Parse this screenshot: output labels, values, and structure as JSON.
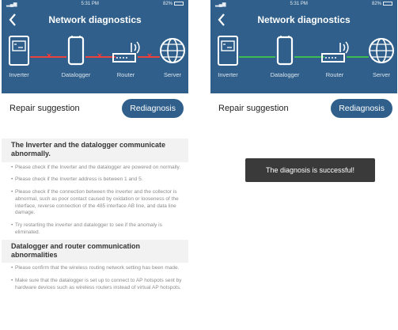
{
  "colors": {
    "header_blue": "#2f5f8a",
    "link_failed": "#e8443f",
    "link_ok": "#3cba54",
    "toast_bg": "#3a3a3a",
    "section_bg": "#f2f2f2"
  },
  "screens": [
    {
      "status": {
        "time": "5:31 PM",
        "battery": "82%"
      },
      "title": "Network diagnostics",
      "devices": [
        {
          "label": "Inverter",
          "icon": "inverter-icon"
        },
        {
          "label": "Datalogger",
          "icon": "datalogger-icon"
        },
        {
          "label": "Router",
          "icon": "router-icon"
        },
        {
          "label": "Server",
          "icon": "globe-icon"
        }
      ],
      "link_state": "failed",
      "repair_label": "Repair suggestion",
      "rediagnosis_label": "Rediagnosis",
      "sections": [
        {
          "heading": "The Inverter and the datalogger communicate abnormally.",
          "items": [
            "Please check if the Inverter and the datalogger are powered on normally.",
            "Please check if the Inverter address is between 1 and 5.",
            "Please check if the connection between the inverter and the collector is abnormal, such as poor contact caused by oxidation or looseness of the interface, reverse connection of the 485 interface AB line, and data line damage.",
            "Try restarting the inverter and datalogger to see if the anomaly is eliminated."
          ]
        },
        {
          "heading": "Datalogger and router communication abnormalities",
          "items": [
            "Please confirm that the wireless routing network setting has been made.",
            "Make sure that the datalogger is set up to connect to AP hotspots sent by hardware devices such as wireless routers instead of virtual AP hotspots."
          ]
        }
      ]
    },
    {
      "status": {
        "time": "5:31 PM",
        "battery": "82%"
      },
      "title": "Network diagnostics",
      "devices": [
        {
          "label": "Inverter",
          "icon": "inverter-icon"
        },
        {
          "label": "Datalogger",
          "icon": "datalogger-icon"
        },
        {
          "label": "Router",
          "icon": "router-icon"
        },
        {
          "label": "Server",
          "icon": "globe-icon"
        }
      ],
      "link_state": "ok",
      "repair_label": "Repair suggestion",
      "rediagnosis_label": "Rediagnosis",
      "toast": "The diagnosis is successful!"
    }
  ]
}
